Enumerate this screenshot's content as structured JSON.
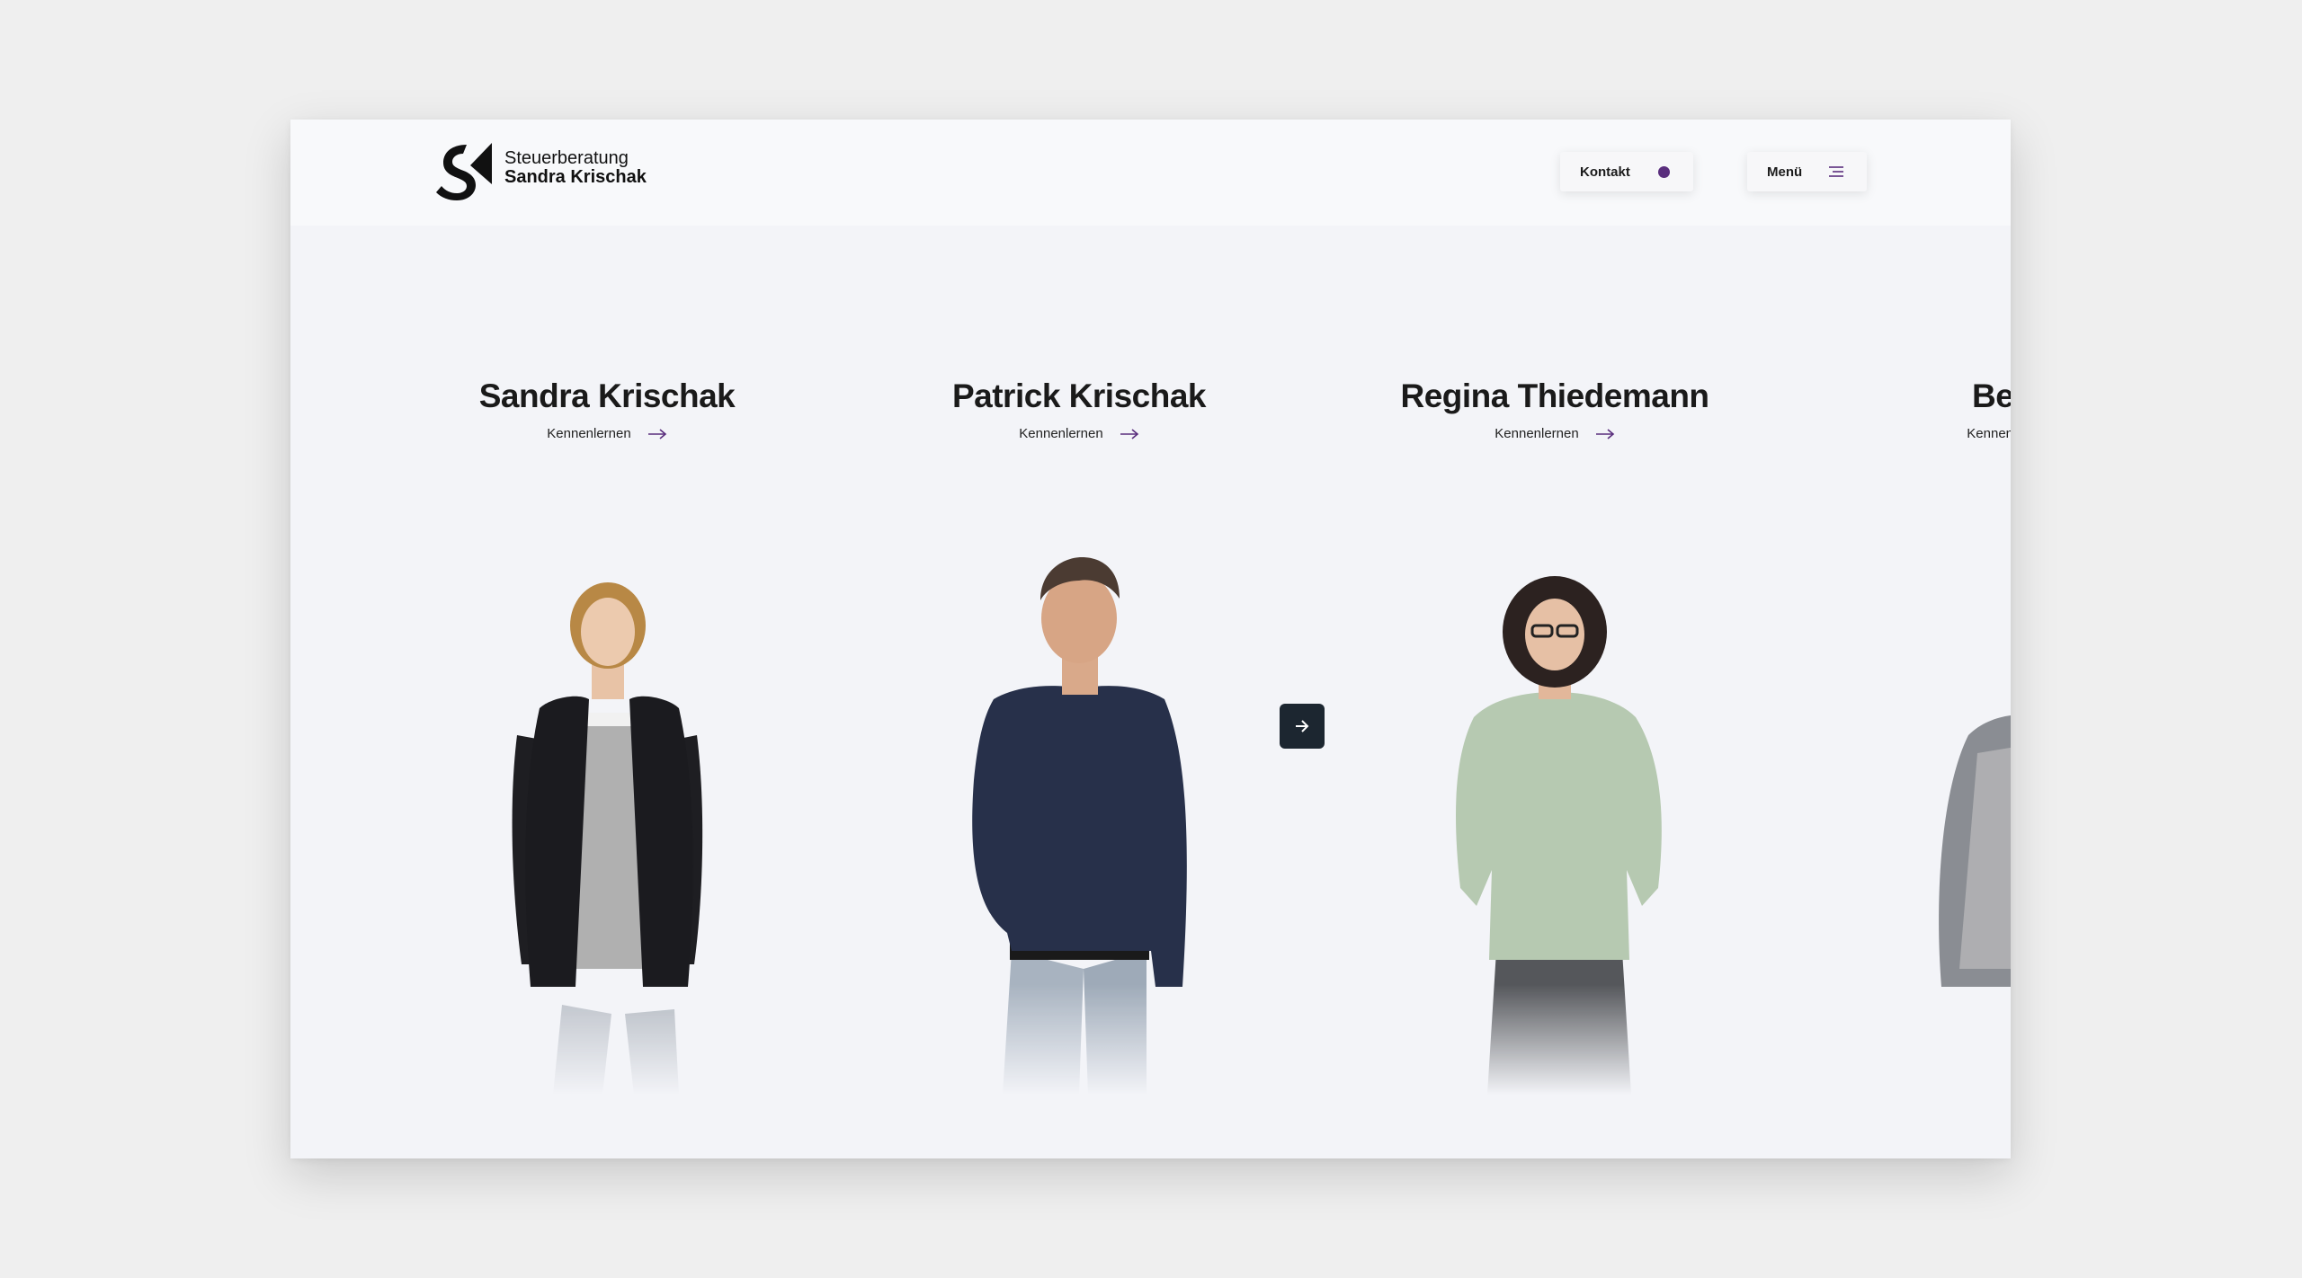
{
  "brand": {
    "line1": "Steuerberatung",
    "line2": "Sandra Krischak",
    "logo_icon": "sk-monogram-logo"
  },
  "nav": {
    "kontakt_label": "Kontakt",
    "kontakt_icon": "purple-dot-icon",
    "menu_label": "Menü",
    "menu_icon": "hamburger-icon"
  },
  "team": [
    {
      "name": "Sandra Krischak",
      "link_label": "Kennenlernen"
    },
    {
      "name": "Patrick Krischak",
      "link_label": "Kennenlernen"
    },
    {
      "name": "Regina Thiedemann",
      "link_label": "Kennenlernen"
    },
    {
      "name": "Bettina",
      "link_label": "Kennenlernen"
    }
  ],
  "carousel": {
    "next_icon": "arrow-right-icon"
  },
  "colors": {
    "accent": "#5a2e7d",
    "dark_button": "#1c2630",
    "page_background": "#f3f4f8",
    "outer_background": "#efefef"
  }
}
